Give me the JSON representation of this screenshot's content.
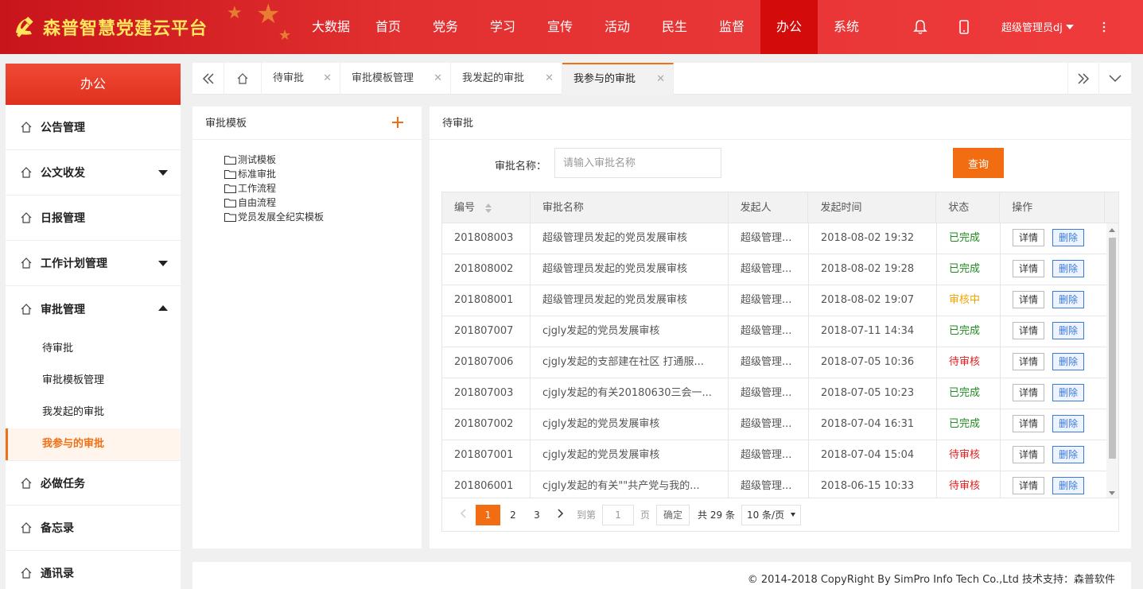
{
  "brand": {
    "title": "森普智慧党建云平台"
  },
  "nav": [
    "大数据",
    "首页",
    "党务",
    "学习",
    "宣传",
    "活动",
    "民生",
    "监督",
    "办公",
    "系统"
  ],
  "nav_active": "办公",
  "header_icons": {
    "bell": "bell-icon",
    "mobile": "mobile-icon",
    "more": "more-vertical-icon"
  },
  "user": {
    "name": "超级管理员dj"
  },
  "sidebar": {
    "title": "办公",
    "items": [
      {
        "label": "公告管理"
      },
      {
        "label": "公文收发"
      },
      {
        "label": "日报管理"
      },
      {
        "label": "工作计划管理"
      },
      {
        "label": "审批管理"
      },
      {
        "label": "必做任务"
      },
      {
        "label": "备忘录"
      },
      {
        "label": "通讯录"
      }
    ],
    "sub_items": [
      "待审批",
      "审批模板管理",
      "我发起的审批",
      "我参与的审批"
    ]
  },
  "tabs": [
    "待审批",
    "审批模板管理",
    "我发起的审批",
    "我参与的审批"
  ],
  "templates": {
    "title": "审批模板",
    "items": [
      "测试模板",
      "标准审批",
      "工作流程",
      "自由流程",
      "党员发展全纪实模板"
    ]
  },
  "main": {
    "title": "待审批",
    "search_label": "审批名称：",
    "search_placeholder": "请输入审批名称",
    "search_button": "查询",
    "columns": [
      "编号",
      "审批名称",
      "发起人",
      "发起时间",
      "状态",
      "操作"
    ],
    "detail_label": "详情",
    "delete_label": "删除",
    "rows": [
      {
        "id": "201808003",
        "name": "超级管理员发起的党员发展审核",
        "initiator": "超级管理...",
        "time": "2018-08-02 19:32",
        "status": "已完成",
        "status_type": "done"
      },
      {
        "id": "201808002",
        "name": "超级管理员发起的党员发展审核",
        "initiator": "超级管理...",
        "time": "2018-08-02 19:28",
        "status": "已完成",
        "status_type": "done"
      },
      {
        "id": "201808001",
        "name": "超级管理员发起的党员发展审核",
        "initiator": "超级管理...",
        "time": "2018-08-02 19:07",
        "status": "审核中",
        "status_type": "review"
      },
      {
        "id": "201807007",
        "name": "cjgly发起的党员发展审核",
        "initiator": "超级管理...",
        "time": "2018-07-11 14:34",
        "status": "已完成",
        "status_type": "done"
      },
      {
        "id": "201807006",
        "name": "cjgly发起的支部建在社区 打通服...",
        "initiator": "超级管理...",
        "time": "2018-07-05 10:36",
        "status": "待审核",
        "status_type": "pending"
      },
      {
        "id": "201807003",
        "name": "cjgly发起的有关20180630三会一...",
        "initiator": "超级管理...",
        "time": "2018-07-05 10:23",
        "status": "已完成",
        "status_type": "done"
      },
      {
        "id": "201807002",
        "name": "cjgly发起的党员发展审核",
        "initiator": "超级管理...",
        "time": "2018-07-04 16:31",
        "status": "已完成",
        "status_type": "done"
      },
      {
        "id": "201807001",
        "name": "cjgly发起的党员发展审核",
        "initiator": "超级管理...",
        "time": "2018-07-04 15:04",
        "status": "待审核",
        "status_type": "pending"
      },
      {
        "id": "201806001",
        "name": "cjgly发起的有关\"\"共产党与我的...",
        "initiator": "超级管理...",
        "time": "2018-06-15 10:33",
        "status": "待审核",
        "status_type": "pending"
      }
    ]
  },
  "pagination": {
    "pages": [
      "1",
      "2",
      "3"
    ],
    "current": "1",
    "goto_label": "到第",
    "goto_value": "1",
    "page_unit": "页",
    "confirm": "确定",
    "total": "共 29 条",
    "page_size": "10 条/页"
  },
  "colors": {
    "accent": "#f26c12",
    "header_red": "#e23030",
    "done": "#1f8a1f",
    "review": "#f0a500",
    "pending": "#e02020"
  },
  "footer": {
    "copyright": "© 2014-2018 CopyRight By SimPro Info Tech Co.,Ltd 技术支持：森普软件"
  }
}
